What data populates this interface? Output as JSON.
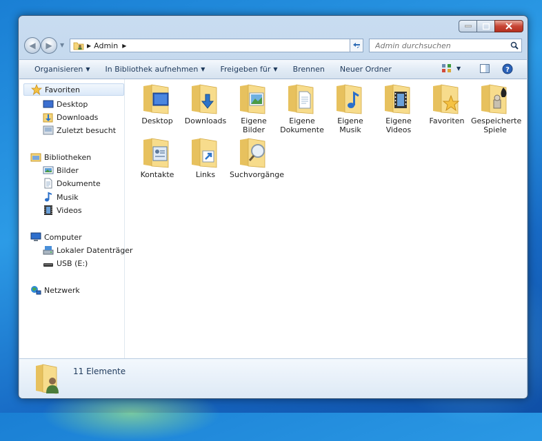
{
  "window": {
    "breadcrumb": [
      "Admin"
    ],
    "search_placeholder": "Admin durchsuchen"
  },
  "toolbar": {
    "organize": "Organisieren",
    "library": "In Bibliothek aufnehmen",
    "share": "Freigeben für",
    "burn": "Brennen",
    "new_folder": "Neuer Ordner"
  },
  "nav": {
    "favorites": "Favoriten",
    "desktop": "Desktop",
    "downloads": "Downloads",
    "recent": "Zuletzt besucht",
    "libraries": "Bibliotheken",
    "pictures": "Bilder",
    "documents": "Dokumente",
    "music": "Musik",
    "videos": "Videos",
    "computer": "Computer",
    "local_disk": "Lokaler Datenträger",
    "usb": "USB (E:)",
    "network": "Netzwerk"
  },
  "items": [
    {
      "label": "Desktop",
      "icon": "desktop-folder-icon"
    },
    {
      "label": "Downloads",
      "icon": "downloads-folder-icon"
    },
    {
      "label": "Eigene Bilder",
      "icon": "pictures-folder-icon"
    },
    {
      "label": "Eigene Dokumente",
      "icon": "documents-folder-icon"
    },
    {
      "label": "Eigene Musik",
      "icon": "music-folder-icon"
    },
    {
      "label": "Eigene Videos",
      "icon": "videos-folder-icon"
    },
    {
      "label": "Favoriten",
      "icon": "favorites-folder-icon"
    },
    {
      "label": "Gespeicherte Spiele",
      "icon": "saved-games-folder-icon"
    },
    {
      "label": "Kontakte",
      "icon": "contacts-folder-icon"
    },
    {
      "label": "Links",
      "icon": "links-folder-icon"
    },
    {
      "label": "Suchvorgänge",
      "icon": "searches-folder-icon"
    }
  ],
  "status": {
    "count": "11 Elemente"
  },
  "colors": {
    "folder": "#f5d57a",
    "folder_dark": "#d9ad3c",
    "toolbar_text": "#1e395b",
    "selection": "#dbe9f9"
  }
}
